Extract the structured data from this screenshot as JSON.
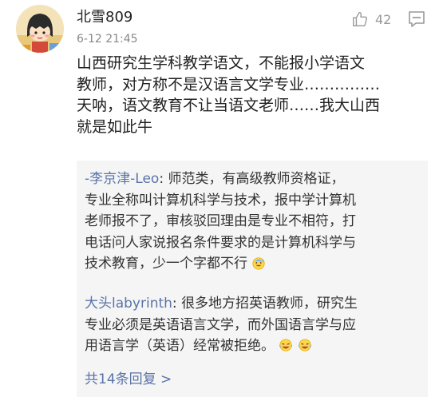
{
  "comment": {
    "user_name": "北雪809",
    "timestamp": "6-12 21:45",
    "like_count": "42",
    "text_lines": [
      "山西研究生学科教学语文，不能报小学语文",
      "教师，对方称不是汉语言文学专业……………",
      "天呐，语文教育不让当语文老师……我大山西",
      "就是如此牛"
    ]
  },
  "replies": [
    {
      "author": "-李京津-Leo",
      "first_line": "师范类，有高级教师资格证，",
      "lines": [
        "专业全称叫计算机科学与技术，报中学计算机",
        "老师报不了，审核驳回理由是专业不相符，打",
        "电话问人家说报名条件要求的是计算机科学与"
      ],
      "last_line": "技术教育，少一个字都不行",
      "emoji": "sweat-smile-emoji"
    },
    {
      "author": "大头labyrinth",
      "first_line": "很多地方招英语教师，研究生",
      "lines": [
        "专业必须是英语语言文学，而外国语言学与应"
      ],
      "last_line": "用语言学（英语）经常被拒绝。",
      "emoji": "crying-laughing-emoji"
    }
  ],
  "more_replies_label": "共14条回复 >",
  "colors": {
    "link_blue": "#5a74a8",
    "reply_bg": "#f5f5f5",
    "meta_gray": "#888888"
  }
}
